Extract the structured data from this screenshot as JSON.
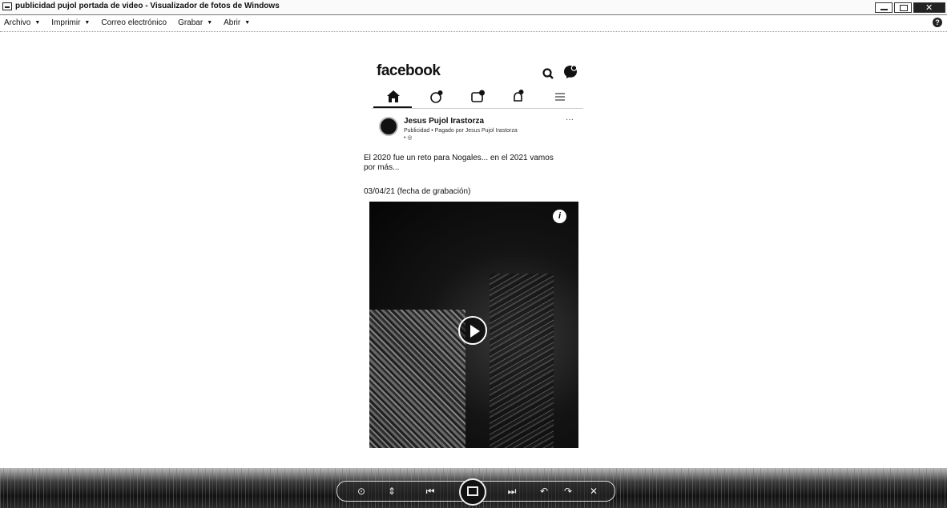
{
  "window": {
    "title": "publicidad pujol portada de video - Visualizador de fotos de Windows"
  },
  "menubar": {
    "items": [
      {
        "label": "Archivo",
        "has_caret": true
      },
      {
        "label": "Imprimir",
        "has_caret": true
      },
      {
        "label": "Correo electrónico",
        "has_caret": false
      },
      {
        "label": "Grabar",
        "has_caret": true
      },
      {
        "label": "Abrir",
        "has_caret": true
      }
    ],
    "caret": "▼",
    "help": "?"
  },
  "facebook": {
    "logo": "facebook",
    "post": {
      "author": "Jesus Pujol Irastorza",
      "meta": "Publicidad • Pagado por Jesus Pujol Irastorza",
      "meta_line2": "• ◎",
      "more": "···",
      "text": "El 2020 fue un reto para Nogales... en el 2021 vamos por más...",
      "date": "03/04/21 (fecha de grabación)"
    },
    "video": {
      "info_icon_label": "i"
    }
  },
  "colors": {
    "text": "#111111",
    "bar": "#1a1a1a",
    "background": "#ffffff"
  }
}
